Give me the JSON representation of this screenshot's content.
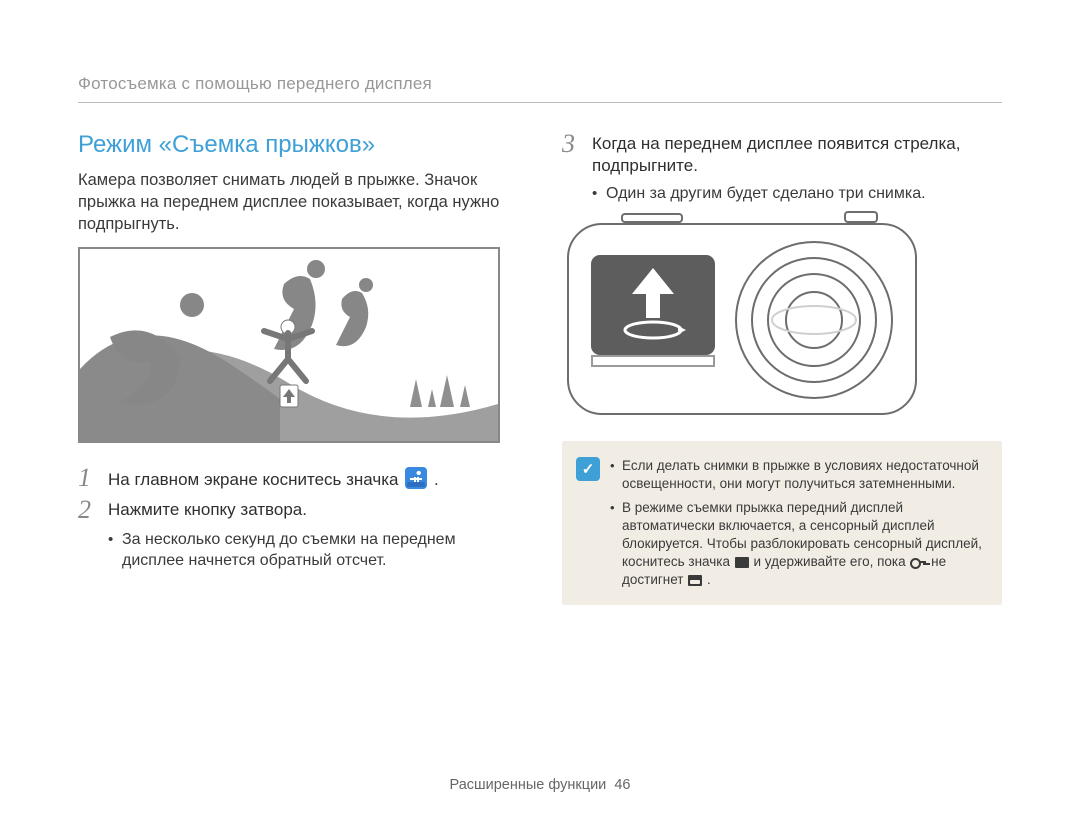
{
  "header": "Фотосъемка с помощью переднего дисплея",
  "left": {
    "title": "Режим «Съемка прыжков»",
    "intro": "Камера позволяет снимать людей в прыжке. Значок прыжка на переднем дисплее показывает, когда нужно подпрыгнуть.",
    "step1": {
      "num": "1",
      "text_before_icon": "На главном экране коснитесь значка ",
      "text_after_icon": "."
    },
    "step2": {
      "num": "2",
      "text": "Нажмите кнопку затвора.",
      "bullet": "За несколько секунд до съемки на переднем дисплее начнется обратный отсчет."
    }
  },
  "right": {
    "step3": {
      "num": "3",
      "text": "Когда на переднем дисплее появится стрелка, подпрыгните.",
      "bullet": "Один за другим будет сделано три снимка."
    },
    "note": {
      "badge_glyph": "✓",
      "items": [
        "Если делать снимки в прыжке в условиях недостаточной освещенности, они могут получиться затемненными.",
        {
          "pre": "В режиме съемки прыжка передний дисплей автоматически включается, а сенсорный дисплей блокируется. Чтобы разблокировать сенсорный дисплей, коснитесь значка ",
          "mid": " и удерживайте его, пока ",
          "mid2": " не достигнет ",
          "end": "."
        }
      ]
    }
  },
  "footer": {
    "section": "Расширенные функции",
    "page": "46"
  }
}
